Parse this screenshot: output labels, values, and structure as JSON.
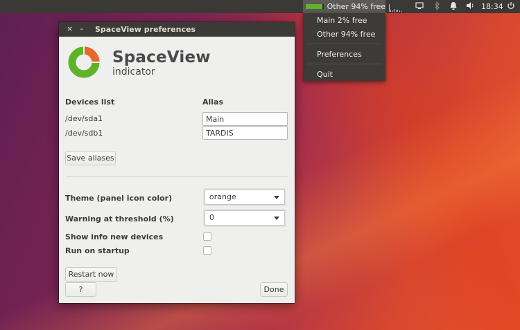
{
  "top_panel": {
    "indicator_text": "Other 94% free",
    "indicator_used_fraction": 0.94,
    "clock": "18:34",
    "icons": [
      "usage-graph-icon",
      "display-icon",
      "bluetooth-icon",
      "notification-bell-icon",
      "volume-icon",
      "power-icon"
    ]
  },
  "menu": {
    "items": [
      "Main 2% free",
      "Other 94% free",
      "Preferences",
      "Quit"
    ]
  },
  "window": {
    "title": "SpaceView preferences",
    "close_glyph": "×",
    "minimize_glyph": "–",
    "app_name": "SpaceView",
    "app_subtitle": "indicator",
    "devices_header": "Devices list",
    "alias_header": "Alias",
    "devices": [
      {
        "device": "/dev/sda1",
        "alias": "Main"
      },
      {
        "device": "/dev/sdb1",
        "alias": "TARDIS"
      }
    ],
    "save_aliases_label": "Save aliases",
    "theme_label": "Theme (panel icon color)",
    "theme_value": "orange",
    "threshold_label": "Warning at threshold (%)",
    "threshold_value": "0",
    "show_info_label": "Show info new devices",
    "run_startup_label": "Run on startup",
    "restart_label": "Restart now",
    "help_label": "?",
    "done_label": "Done"
  },
  "colors": {
    "logo_green": "#5fb329",
    "logo_orange": "#e8672b",
    "panel_bg": "#3a3936"
  }
}
